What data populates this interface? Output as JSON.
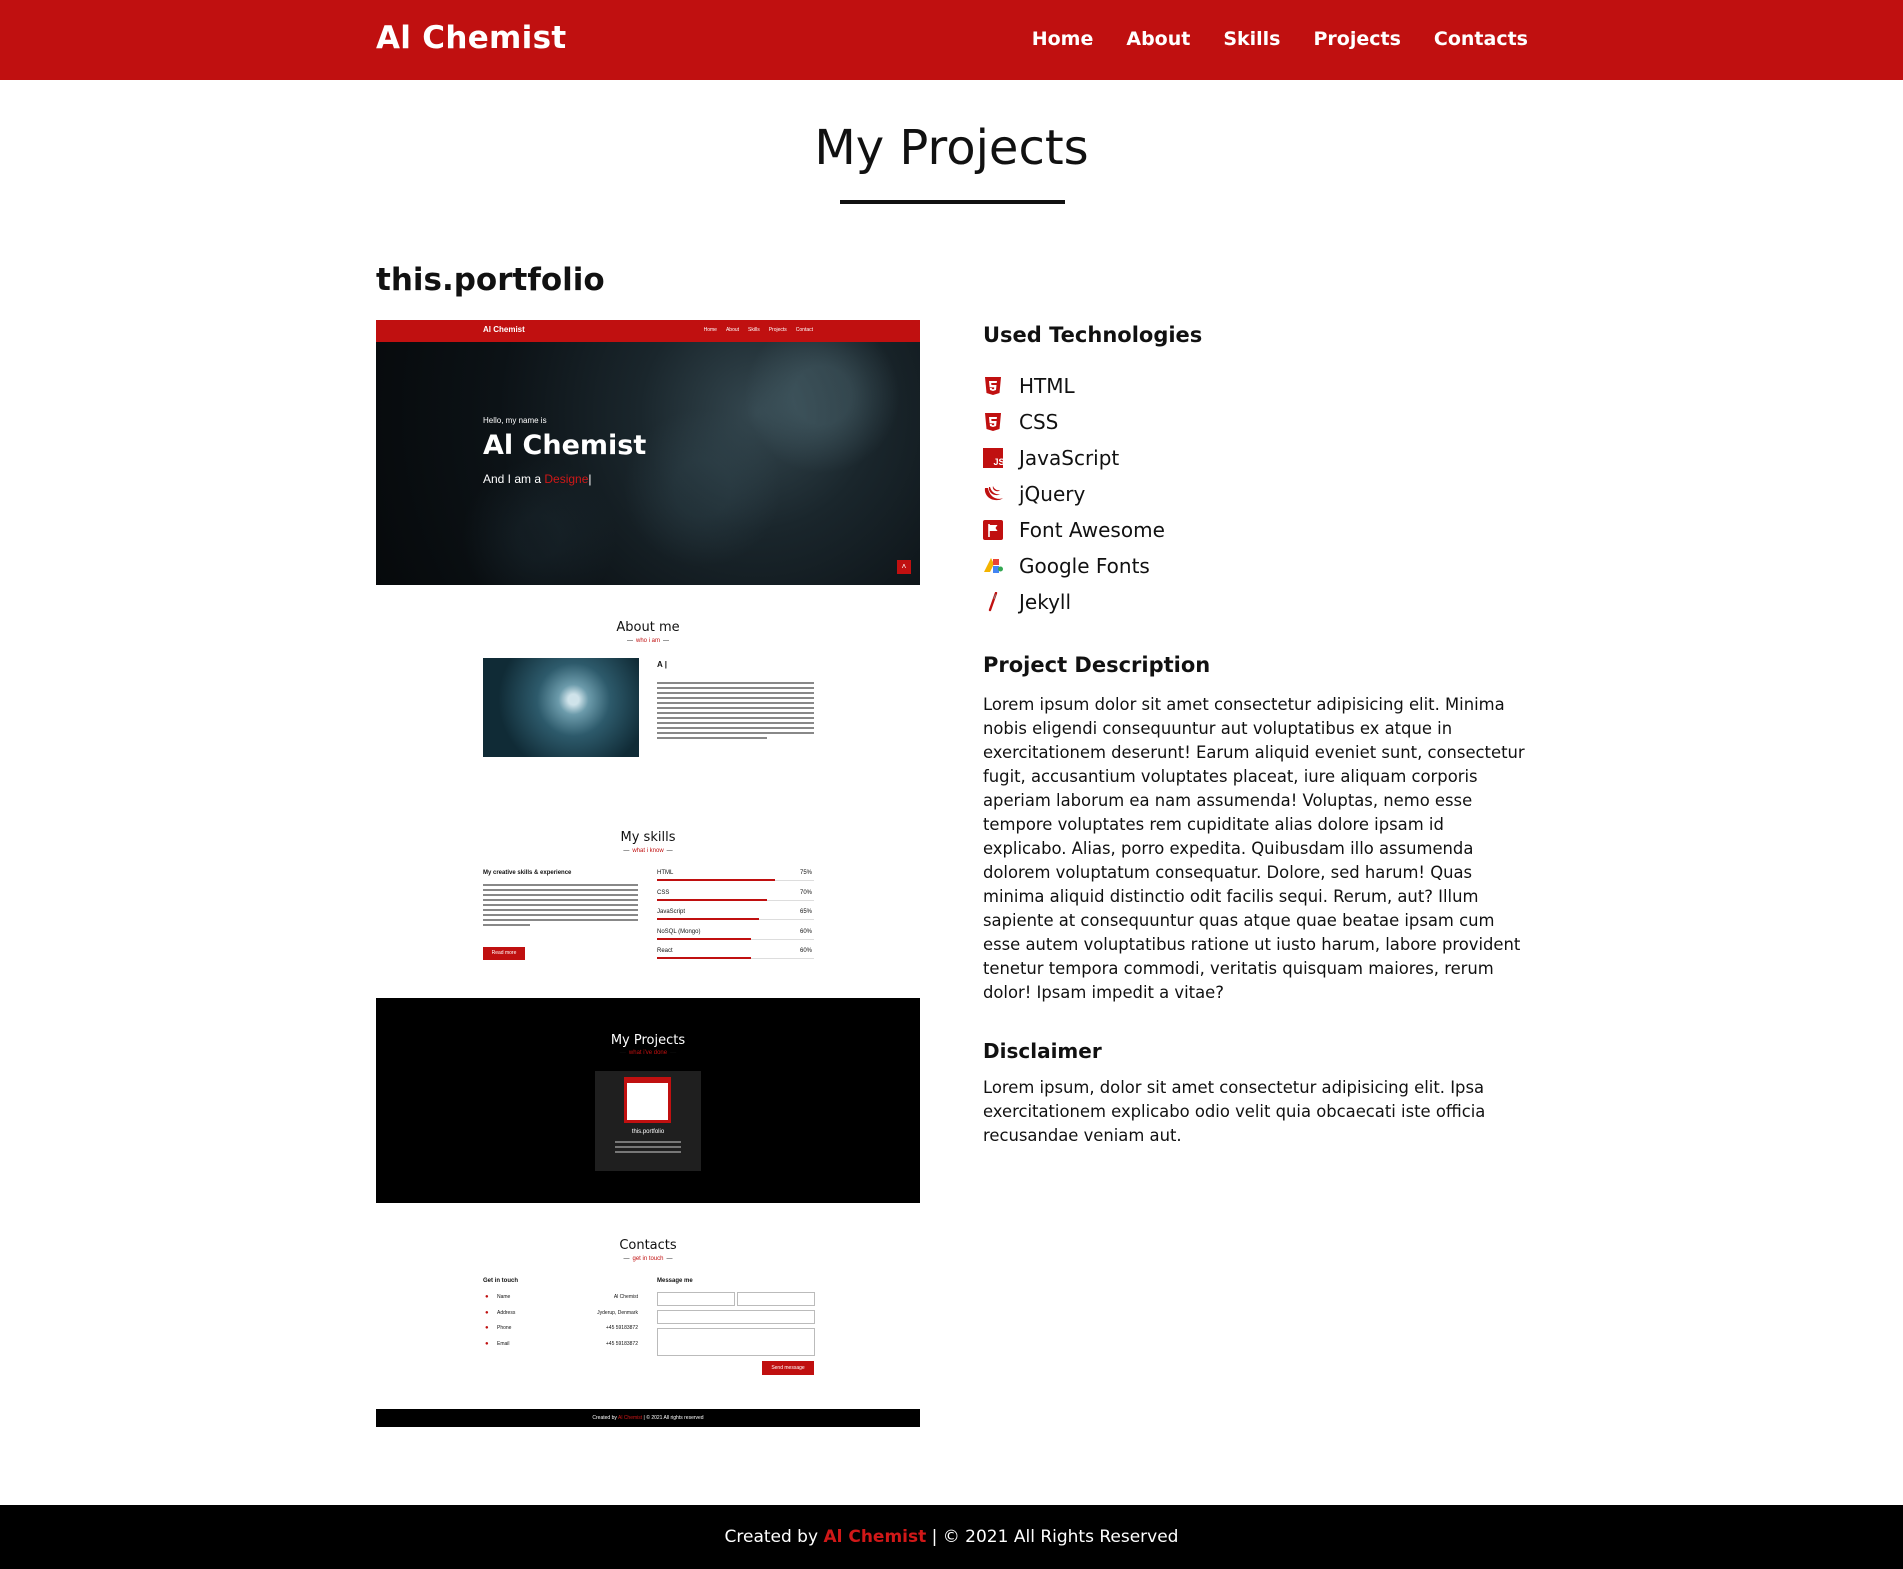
{
  "nav": {
    "brand": "Al Chemist",
    "links": [
      "Home",
      "About",
      "Skills",
      "Projects",
      "Contacts"
    ]
  },
  "section": {
    "title": "My Projects",
    "project_name": "this.portfolio"
  },
  "preview": {
    "nav_brand": "Al Chemist",
    "nav_links": [
      "Home",
      "About",
      "Skills",
      "Projects",
      "Contact"
    ],
    "hello": "Hello, my name is",
    "hero_name": "Al Chemist",
    "iam_prefix": "And I am a ",
    "iam_role": "Designe",
    "about_title": "About me",
    "about_sub": "who i am",
    "about_name": "A |",
    "skills_title": "My skills",
    "skills_sub": "what i know",
    "skills_heading": "My creative skills & experience",
    "read_more": "Read more",
    "skills": [
      {
        "name": "HTML",
        "percent": "75%",
        "fraction": 0.75
      },
      {
        "name": "CSS",
        "percent": "70%",
        "fraction": 0.7
      },
      {
        "name": "JavaScript",
        "percent": "65%",
        "fraction": 0.65
      },
      {
        "name": "NoSQL (Mongo)",
        "percent": "60%",
        "fraction": 0.6
      },
      {
        "name": "React",
        "percent": "60%",
        "fraction": 0.6
      }
    ],
    "projects_title": "My Projects",
    "projects_sub": "what i've done",
    "card_name": "this.portfolio",
    "contacts_title": "Contacts",
    "contacts_sub": "get in touch",
    "get_in_touch": "Get in touch",
    "message_me": "Message me",
    "contact_rows": [
      {
        "label": "Name",
        "value": "Al Chemist"
      },
      {
        "label": "Address",
        "value": "Jyderup, Denmark"
      },
      {
        "label": "Phone",
        "value": "+45 59183872"
      },
      {
        "label": "Email",
        "value": "+45 59183872"
      }
    ],
    "send_button": "Send message",
    "footer_prefix": "Created by ",
    "footer_name": "Al Chemist",
    "footer_suffix": " | © 2021 All rights reserved"
  },
  "technologies": {
    "heading": "Used Technologies",
    "items": [
      {
        "label": "HTML",
        "icon": "html5-icon"
      },
      {
        "label": "CSS",
        "icon": "css3-icon"
      },
      {
        "label": "JavaScript",
        "icon": "js-icon"
      },
      {
        "label": "jQuery",
        "icon": "jquery-icon"
      },
      {
        "label": "Font Awesome",
        "icon": "font-awesome-icon"
      },
      {
        "label": "Google Fonts",
        "icon": "google-fonts-icon"
      },
      {
        "label": "Jekyll",
        "icon": "jekyll-icon"
      }
    ]
  },
  "description": {
    "heading": "Project Description",
    "text": "Lorem ipsum dolor sit amet consectetur adipisicing elit. Minima nobis eligendi consequuntur aut voluptatibus ex atque in exercitationem deserunt! Earum aliquid eveniet sunt, consectetur fugit, accusantium voluptates placeat, iure aliquam corporis aperiam laborum ea nam assumenda! Voluptas, nemo esse tempore voluptates rem cupiditate alias dolore ipsam id explicabo. Alias, porro expedita. Quibusdam illo assumenda dolorem voluptatum consequatur. Dolore, sed harum! Quas minima aliquid distinctio odit facilis sequi. Rerum, aut? Illum sapiente at consequuntur quas atque quae beatae ipsam cum esse autem voluptatibus ratione ut iusto harum, labore provident tenetur tempora commodi, veritatis quisquam maiores, rerum dolor! Ipsam impedit a vitae?"
  },
  "disclaimer": {
    "heading": "Disclaimer",
    "text": "Lorem ipsum, dolor sit amet consectetur adipisicing elit. Ipsa exercitationem explicabo odio velit quia obcaecati iste officia recusandae veniam aut."
  },
  "footer": {
    "prefix": "Created by ",
    "name": "Al Chemist",
    "suffix": " | © 2021 All Rights Reserved"
  },
  "colors": {
    "accent": "#c01010",
    "footer_bg": "#000000",
    "text": "#111111"
  }
}
